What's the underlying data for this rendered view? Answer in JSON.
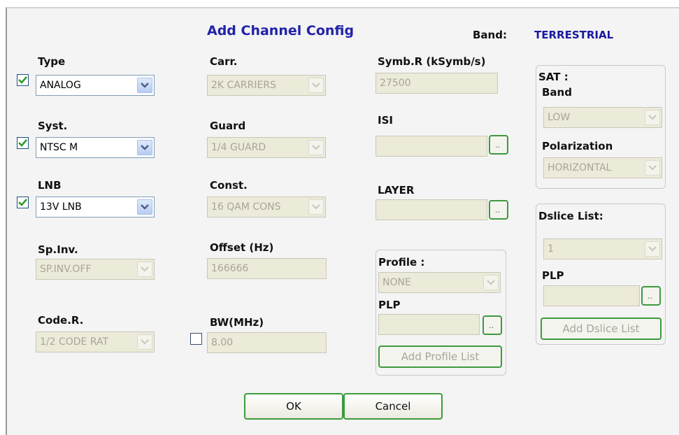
{
  "dialog": {
    "title": "Add Channel Config",
    "band_label": "Band:",
    "band_value": "TERRESTRIAL"
  },
  "col1": {
    "type_label": "Type",
    "type_value": "ANALOG",
    "syst_label": "Syst.",
    "syst_value": "NTSC M",
    "lnb_label": "LNB",
    "lnb_value": "13V LNB",
    "spinv_label": "Sp.Inv.",
    "spinv_value": "SP.INV.OFF",
    "coder_label": "Code.R.",
    "coder_value": "1/2 CODE RAT"
  },
  "col2": {
    "carr_label": "Carr.",
    "carr_value": "2K CARRIERS",
    "guard_label": "Guard",
    "guard_value": "1/4 GUARD",
    "const_label": "Const.",
    "const_value": "16 QAM CONS",
    "offset_label": "Offset (Hz)",
    "offset_value": "166666",
    "bw_label": "BW(MHz)",
    "bw_value": "8.00"
  },
  "col3": {
    "symb_label": "Symb.R (kSymb/s)",
    "symb_value": "27500",
    "isi_label": "ISI",
    "layer_label": "LAYER",
    "profile_label": "Profile :",
    "profile_value": "NONE",
    "plp_label": "PLP",
    "add_profile_label": "Add Profile List",
    "dots": ".."
  },
  "sat": {
    "title": "SAT :",
    "band_label": "Band",
    "band_value": "LOW",
    "pol_label": "Polarization",
    "pol_value": "HORIZONTAL"
  },
  "dslice": {
    "label": "Dslice List:",
    "value": "1",
    "plp_label": "PLP",
    "add_label": "Add Dslice List",
    "dots": ".."
  },
  "buttons": {
    "ok": "OK",
    "cancel": "Cancel"
  },
  "checkboxes": {
    "type": true,
    "syst": true,
    "lnb": true,
    "bw": false
  },
  "colors": {
    "title": "#2222aa",
    "band_value": "#1a1aa0",
    "button_border": "#3d9a3d",
    "check": "#2a9a2a"
  }
}
